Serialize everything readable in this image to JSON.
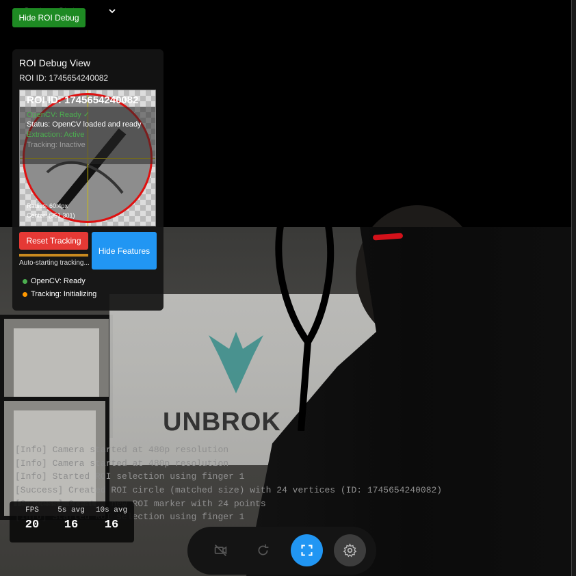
{
  "status": {
    "label": "System Status",
    "indicator_color": "#2ecc40"
  },
  "hide_roi_button": "Hide ROI Debug",
  "roi_panel": {
    "title": "ROI Debug View",
    "roi_id_label": "ROI ID: 1745654240082",
    "overlay": {
      "title": "ROI ID: 1745654240082",
      "opencv": "OpenCV: Ready ✓",
      "status": "Status: OpenCV loaded and ready",
      "extraction": "Extraction: Active",
      "tracking": "Tracking: Inactive",
      "radius": "Radius: 60.4px",
      "center": "Center: (351 301)"
    },
    "reset_button": "Reset Tracking",
    "hide_features_button": "Hide Features",
    "progress_fraction": 1.0,
    "auto_status": "Auto-starting tracking...",
    "indicators": [
      {
        "label": "OpenCV: Ready",
        "color": "#4caf50"
      },
      {
        "label": "Tracking: Initializing",
        "color": "#ff9800"
      }
    ]
  },
  "background": {
    "poster_text": "UNBROK"
  },
  "log": [
    "[Info] Camera started at 480p resolution",
    "[Info] Camera started at 480p resolution",
    "[Info] Started ROI selection using finger 1",
    "[Success] Created ROI circle (matched size) with 24 vertices (ID: 1745654240082)",
    "[Success] Created new ROI marker with 24 points",
    "[Info] Started ROI selection using finger 1"
  ],
  "fps": {
    "items": [
      {
        "label": "FPS",
        "value": "20"
      },
      {
        "label": "5s avg",
        "value": "16"
      },
      {
        "label": "10s avg",
        "value": "16"
      }
    ]
  },
  "toolbar": {
    "icons": [
      "camera-off-icon",
      "refresh-icon",
      "fullscreen-icon",
      "gear-icon"
    ],
    "active_color": "#2196f3"
  }
}
